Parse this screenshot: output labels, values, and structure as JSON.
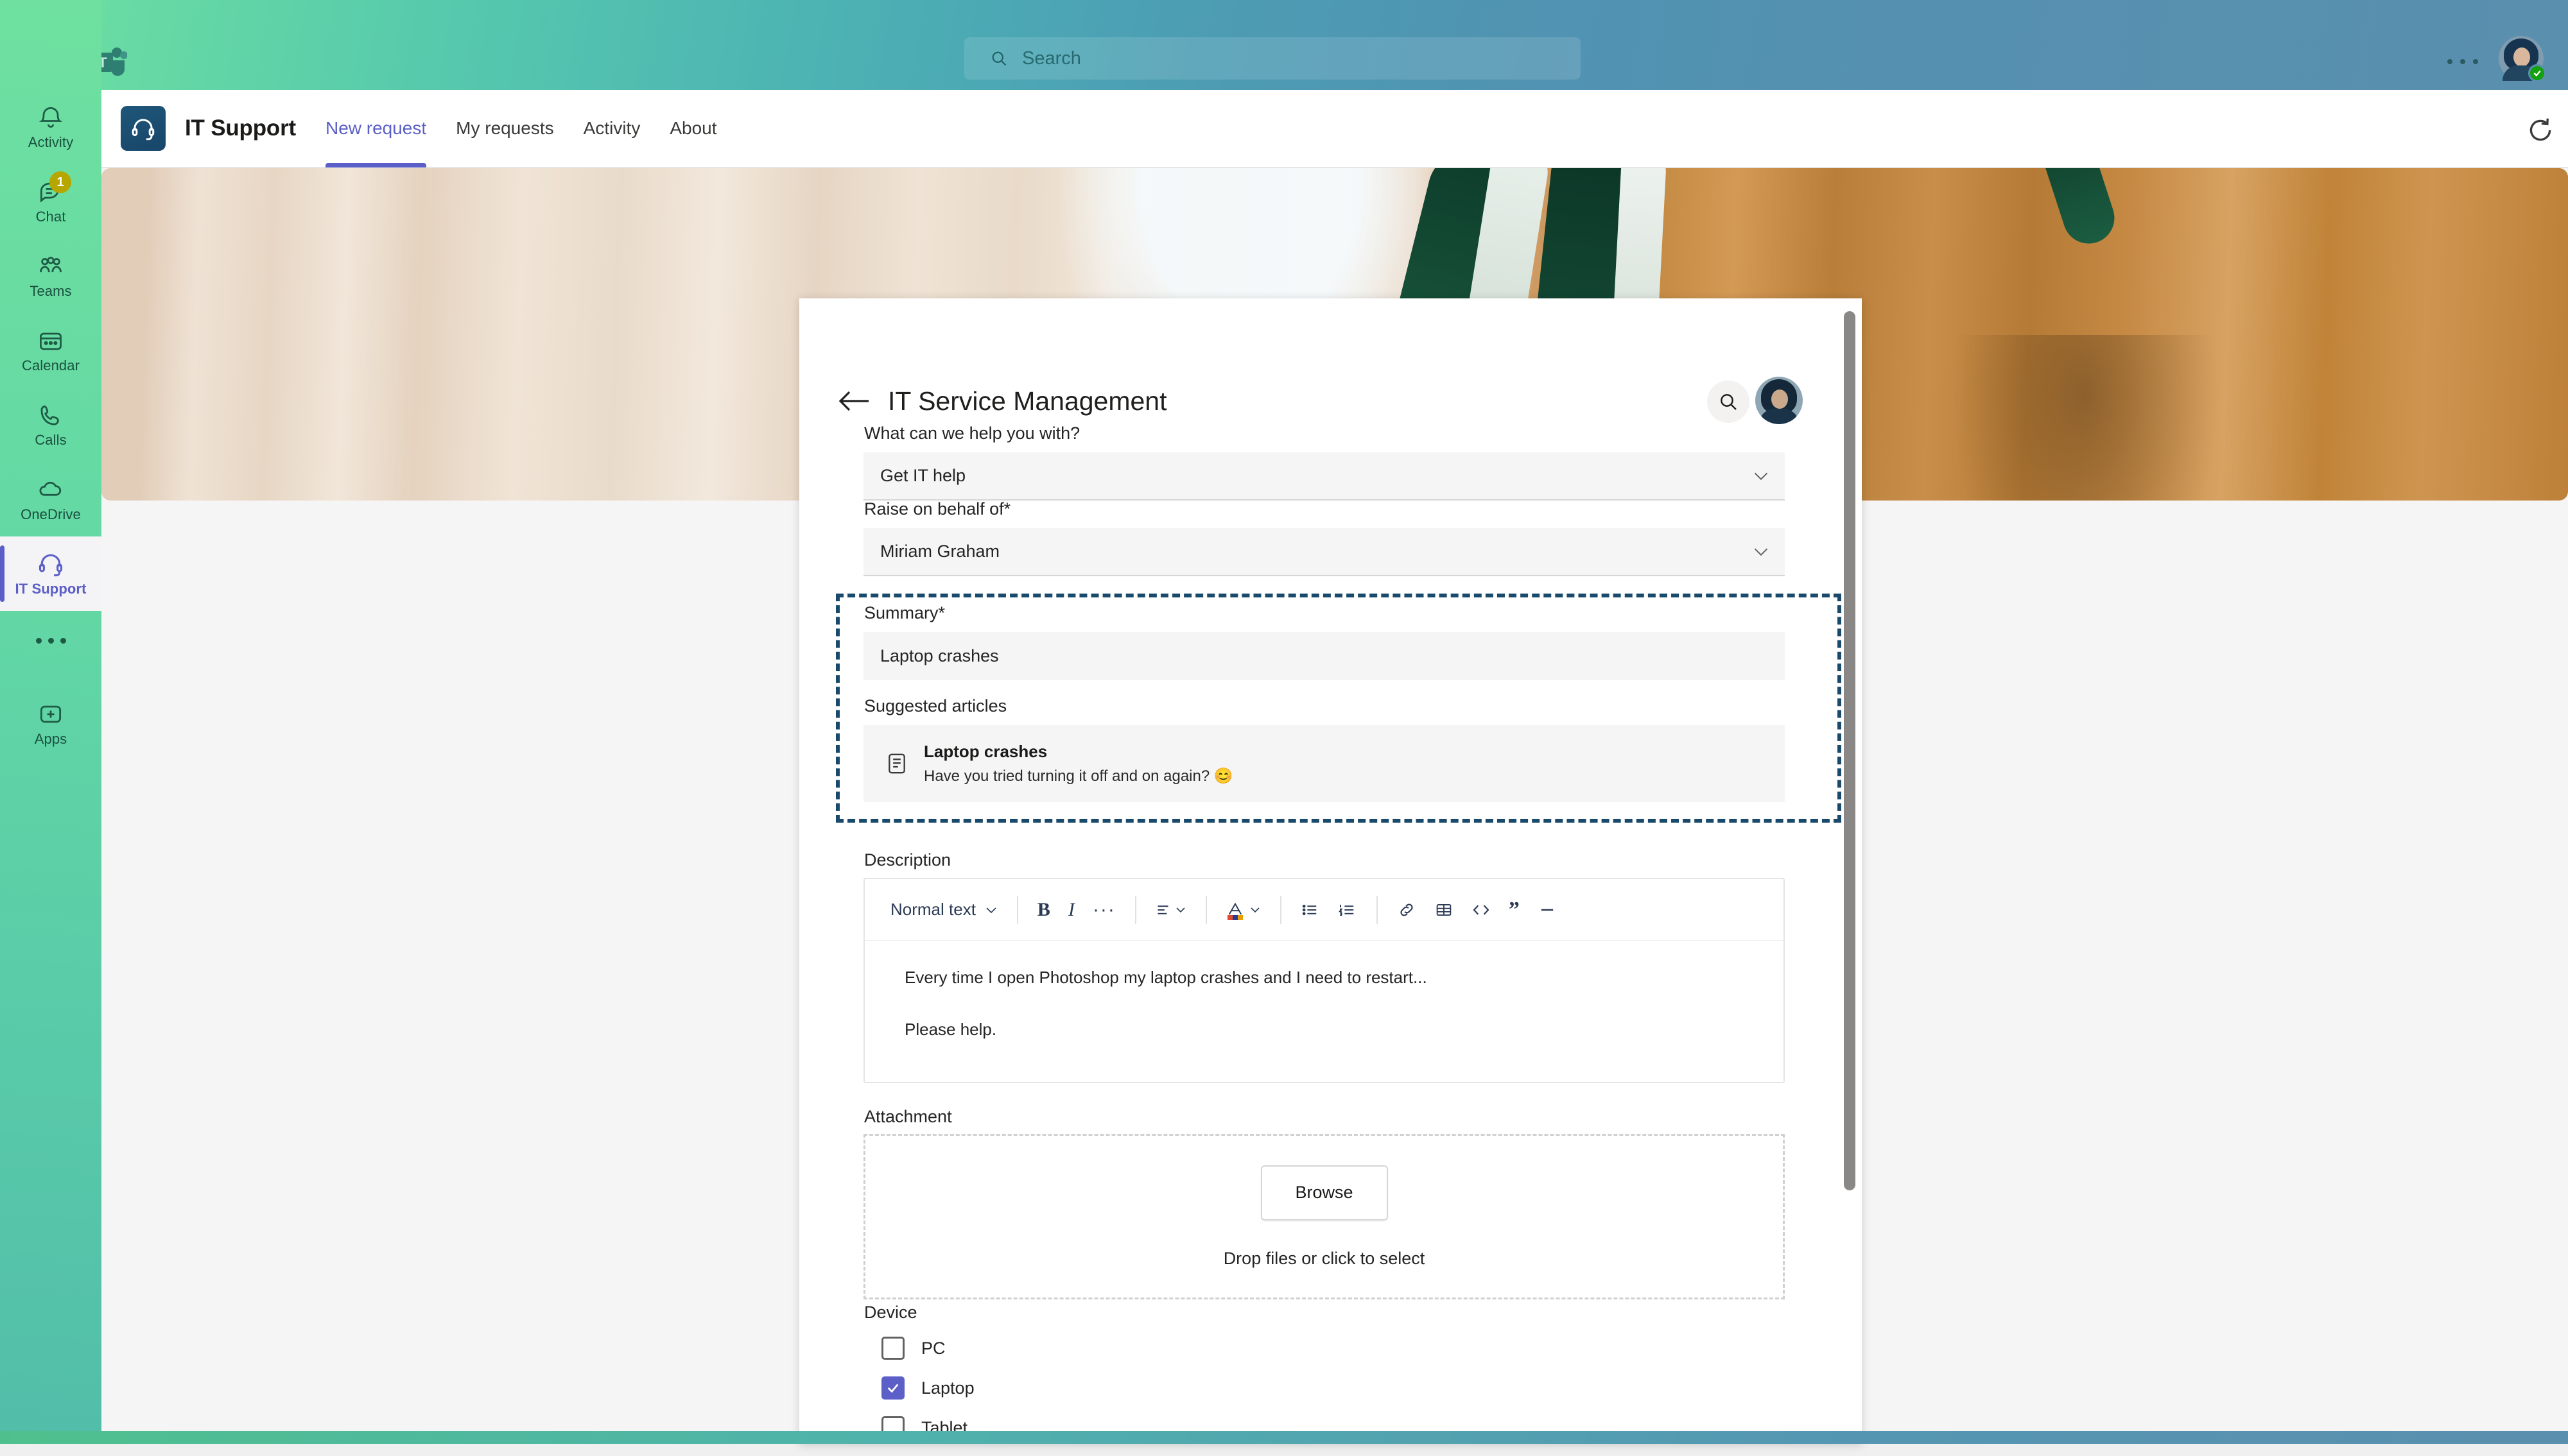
{
  "teams_bar": {
    "waffle_icon": "app-launcher-icon",
    "logo_icon": "microsoft-teams-logo",
    "search": {
      "placeholder": "Search",
      "icon": "search-icon"
    },
    "more_label": "more-options-icon",
    "avatar": {
      "name": "avatar",
      "presence": "available"
    }
  },
  "rail": {
    "items": [
      {
        "label": "Activity",
        "icon": "bell-icon",
        "badge": "",
        "active": false
      },
      {
        "label": "Chat",
        "icon": "chat-icon",
        "badge": "1",
        "active": false
      },
      {
        "label": "Teams",
        "icon": "teams-people-icon",
        "badge": "",
        "active": false
      },
      {
        "label": "Calendar",
        "icon": "calendar-icon",
        "badge": "",
        "active": false
      },
      {
        "label": "Calls",
        "icon": "phone-icon",
        "badge": "",
        "active": false
      },
      {
        "label": "OneDrive",
        "icon": "cloud-icon",
        "badge": "",
        "active": false
      },
      {
        "label": "IT Support",
        "icon": "headset-icon",
        "badge": "",
        "active": true
      }
    ],
    "more_icon": "ellipsis-icon",
    "apps_label": "Apps",
    "apps_icon": "apps-plus-icon"
  },
  "app_header": {
    "logo_icon": "headset-app-icon",
    "title": "IT Support",
    "tabs": [
      {
        "label": "New request",
        "selected": true
      },
      {
        "label": "My requests",
        "selected": false
      },
      {
        "label": "Activity",
        "selected": false
      },
      {
        "label": "About",
        "selected": false
      }
    ],
    "refresh_icon": "refresh-icon"
  },
  "card": {
    "back_icon": "back-arrow-icon",
    "title": "IT Service Management",
    "search_icon": "search-icon",
    "avatar_icon": "user-avatar"
  },
  "form": {
    "help_label": "What can we help you with?",
    "help_value": "Get IT help",
    "behalf_label": "Raise on behalf of*",
    "behalf_value": "Miriam Graham",
    "summary_label": "Summary*",
    "summary_value": "Laptop crashes",
    "suggested_label": "Suggested articles",
    "suggested": [
      {
        "icon": "article-icon",
        "title": "Laptop crashes",
        "subtitle": "Have you tried turning it off and on again? 😊"
      }
    ],
    "description_label": "Description",
    "toolbar": {
      "style_label": "Normal text",
      "items": [
        "bold-icon",
        "italic-icon",
        "more-formatting-icon",
        "align-icon",
        "font-color-icon",
        "bullet-list-icon",
        "numbered-list-icon",
        "link-icon",
        "table-icon",
        "code-icon",
        "quote-icon",
        "divider-icon"
      ]
    },
    "description_paragraphs": [
      "Every time I open Photoshop my laptop crashes and I need to restart...",
      "Please help."
    ],
    "attachment_label": "Attachment",
    "browse_label": "Browse",
    "drop_label": "Drop files or click to select",
    "device_label": "Device",
    "devices": [
      {
        "label": "PC",
        "checked": false
      },
      {
        "label": "Laptop",
        "checked": true
      },
      {
        "label": "Tablet",
        "checked": false
      }
    ]
  },
  "colors": {
    "accent": "#5b5fc7",
    "highlight": "#1a4a6b",
    "badge": "#b5a600",
    "presence": "#13a10e"
  }
}
